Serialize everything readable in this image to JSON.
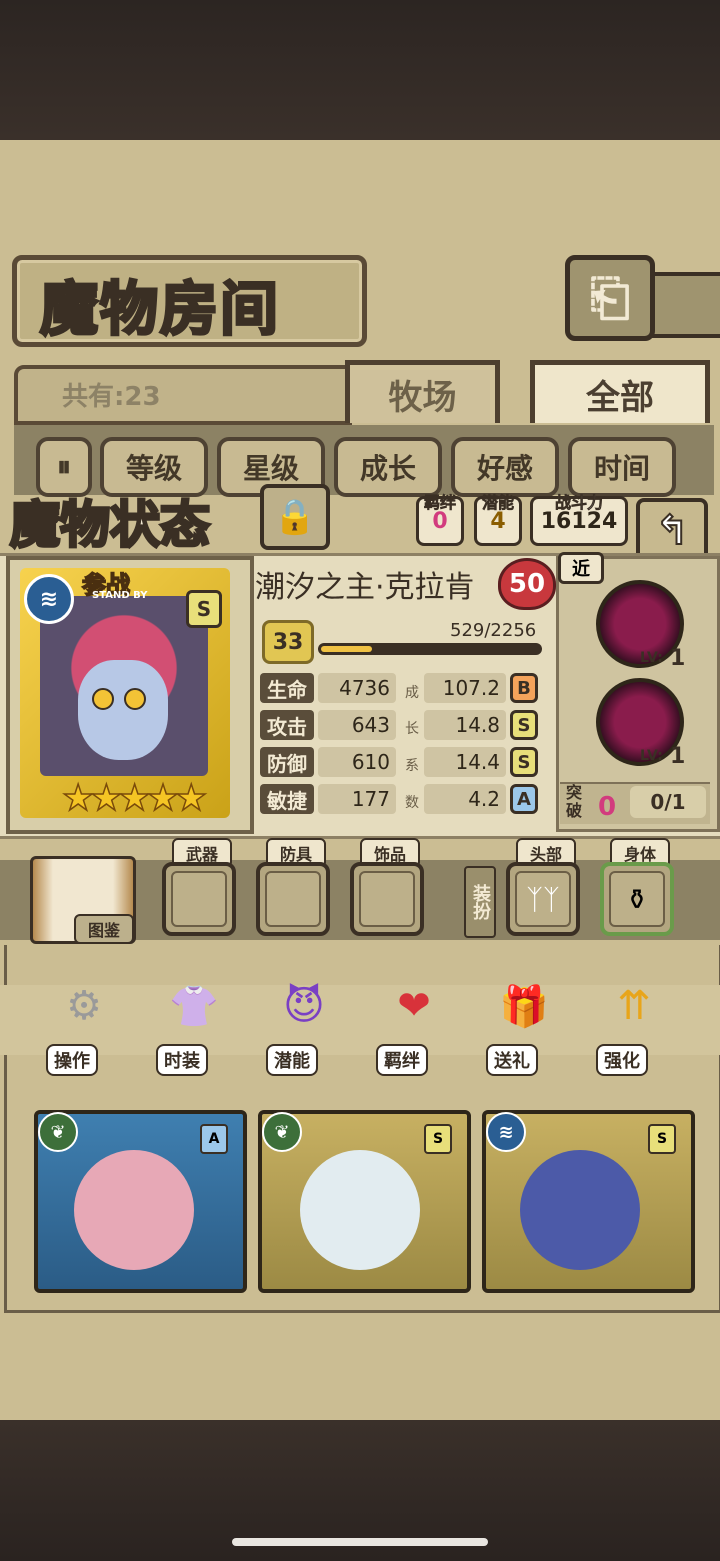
{
  "room": {
    "title": "魔物房间",
    "back_icon": "return-arrow-icon"
  },
  "list": {
    "count_text": "共有:23",
    "tabs": [
      "牧场",
      "全部"
    ],
    "sort_buttons": [
      "等级",
      "星级",
      "成长",
      "好感",
      "时间"
    ],
    "pause_label": "⏸"
  },
  "status": {
    "title": "魔物状态",
    "lock_icon": "lock-icon",
    "bond_label": "羁绊",
    "bond_value": "0",
    "potential_label": "潜能",
    "potential_value": "4",
    "power_label": "战斗力",
    "power_value": "16124",
    "back_icon": "↰"
  },
  "monster": {
    "name": "潮汐之主·克拉肯",
    "heart_level": "50",
    "level": "33",
    "exp_text": "529/2256",
    "exp_fraction": 0.2345,
    "standby": "参战",
    "standby_sub": "STAND BY",
    "rank": "S",
    "attr_icon": "water-wave-icon",
    "stars": "★★★★★",
    "stats": [
      {
        "label": "生命",
        "value": "4736",
        "growth": "107.2",
        "grade": "B"
      },
      {
        "label": "攻击",
        "value": "643",
        "growth": "14.8",
        "grade": "S"
      },
      {
        "label": "防御",
        "value": "610",
        "growth": "14.4",
        "grade": "S"
      },
      {
        "label": "敏捷",
        "value": "177",
        "growth": "4.2",
        "grade": "A"
      }
    ],
    "growth_chars": [
      "成",
      "长",
      "系",
      "数"
    ]
  },
  "skills": {
    "range_tag": "近",
    "items": [
      {
        "lv_label": "LV:",
        "lv": "1"
      },
      {
        "lv_label": "LV:",
        "lv": "1"
      }
    ],
    "break_label": "突破",
    "break_count": "0",
    "break_ratio": "0/1"
  },
  "equipment": {
    "book_label": "图鉴",
    "slots": [
      "武器",
      "防具",
      "饰品"
    ],
    "dress_label": "装扮",
    "dress_slots": [
      "头部",
      "身体"
    ]
  },
  "actions": [
    "操作",
    "时装",
    "潜能",
    "羁绊",
    "送礼",
    "强化"
  ],
  "grid": [
    {
      "attr": "leaf-icon",
      "rank": "A",
      "color": "#3f7fb0"
    },
    {
      "attr": "leaf-icon",
      "rank": "S",
      "color": "#c7b062"
    },
    {
      "attr": "water-wave-icon",
      "rank": "S",
      "color": "#c7b062"
    }
  ]
}
